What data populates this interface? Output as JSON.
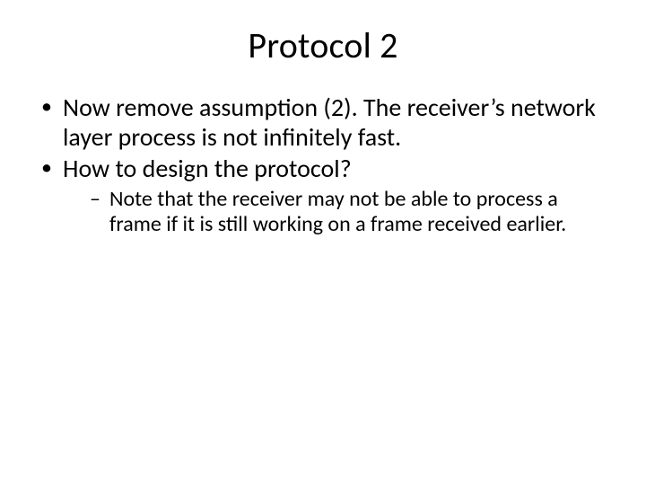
{
  "title": "Protocol 2",
  "bullets": [
    "Now remove assumption (2).  The receiver’s network layer process is not infinitely fast.",
    "How to design the protocol?"
  ],
  "subbullets": [
    "Note that the receiver may not be able to process a frame if it is still working on a frame received earlier."
  ]
}
